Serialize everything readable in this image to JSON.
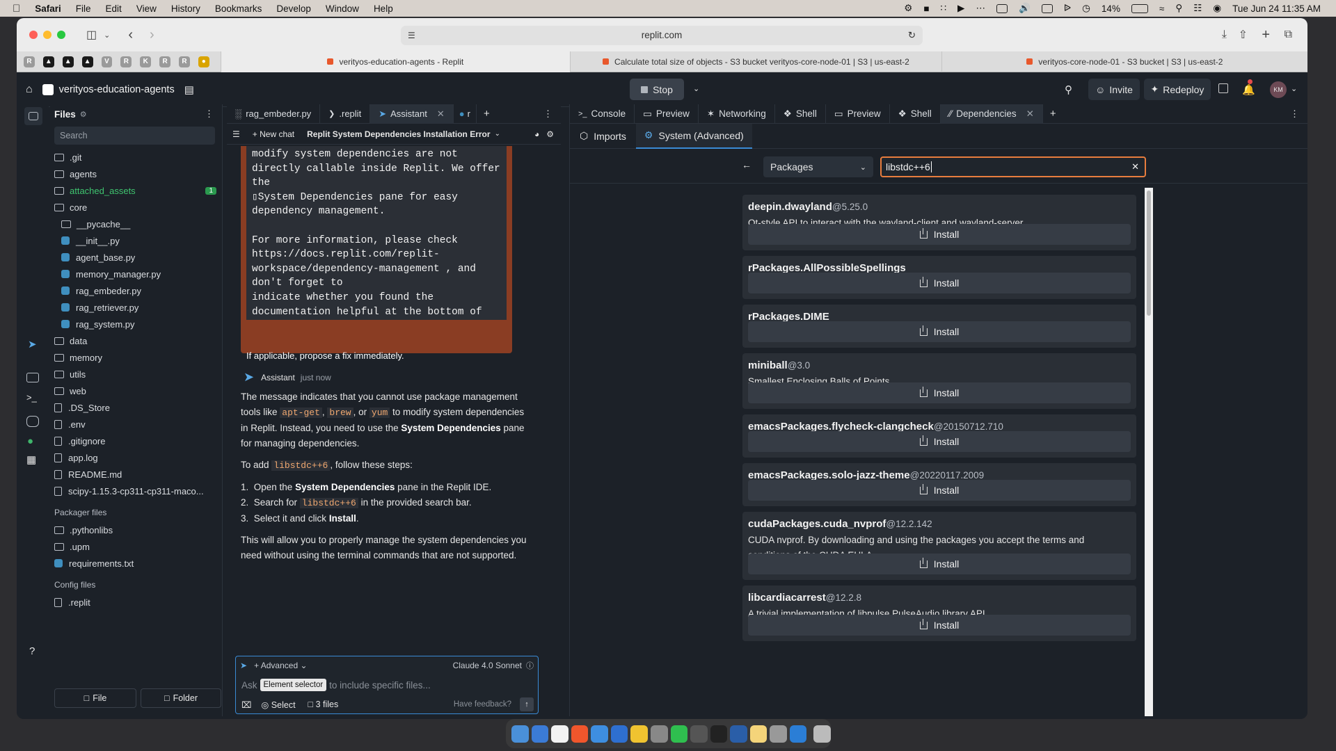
{
  "menubar": {
    "app": "Safari",
    "items": [
      "File",
      "Edit",
      "View",
      "History",
      "Bookmarks",
      "Develop",
      "Window",
      "Help"
    ],
    "battery": "14%",
    "datetime": "Tue Jun 24  11:35 AM"
  },
  "browser": {
    "url": "replit.com",
    "tabs": [
      "verityos-education-agents - Replit",
      "Calculate total size of objects - S3 bucket verityos-core-node-01 | S3 | us-east-2",
      "verityos-core-node-01 - S3 bucket | S3 | us-east-2"
    ],
    "favorites": [
      "R",
      "",
      "",
      "",
      "V",
      "R",
      "K",
      "R",
      "R",
      ""
    ]
  },
  "replit": {
    "project": "verityos-education-agents",
    "stop": "Stop",
    "invite": "Invite",
    "redeploy": "Redeploy",
    "avatar": "KM"
  },
  "files": {
    "header": "Files",
    "search_placeholder": "Search",
    "tree": [
      {
        "name": ".git",
        "type": "folder"
      },
      {
        "name": "agents",
        "type": "folder"
      },
      {
        "name": "attached_assets",
        "type": "folder",
        "badge": "1"
      },
      {
        "name": "core",
        "type": "folder"
      },
      {
        "name": "__pycache__",
        "type": "folder",
        "indent": 1
      },
      {
        "name": "__init__.py",
        "type": "py",
        "indent": 1
      },
      {
        "name": "agent_base.py",
        "type": "py",
        "indent": 1
      },
      {
        "name": "memory_manager.py",
        "type": "py",
        "indent": 1
      },
      {
        "name": "rag_embeder.py",
        "type": "py",
        "indent": 1
      },
      {
        "name": "rag_retriever.py",
        "type": "py",
        "indent": 1
      },
      {
        "name": "rag_system.py",
        "type": "py",
        "indent": 1
      },
      {
        "name": "data",
        "type": "folder"
      },
      {
        "name": "memory",
        "type": "folder"
      },
      {
        "name": "utils",
        "type": "folder"
      },
      {
        "name": "web",
        "type": "folder"
      },
      {
        "name": ".DS_Store",
        "type": "file"
      },
      {
        "name": ".env",
        "type": "file"
      },
      {
        "name": ".gitignore",
        "type": "file"
      },
      {
        "name": "app.log",
        "type": "file"
      },
      {
        "name": "README.md",
        "type": "file"
      },
      {
        "name": "scipy-1.15.3-cp311-cp311-maco...",
        "type": "file"
      }
    ],
    "packager_header": "Packager files",
    "packager": [
      {
        "name": ".pythonlibs",
        "type": "folder"
      },
      {
        "name": ".upm",
        "type": "folder"
      },
      {
        "name": "requirements.txt",
        "type": "py"
      }
    ],
    "config_header": "Config files",
    "config": [
      {
        "name": ".replit",
        "type": "file"
      }
    ],
    "file_btn": "File",
    "folder_btn": "Folder"
  },
  "editor_tabs": [
    "rag_embeder.py",
    ".replit",
    "Assistant",
    "r"
  ],
  "assistant": {
    "new_chat": "New chat",
    "chat_title": "Replit System Dependencies Installation Error",
    "code_block": "modify system dependencies are not\ndirectly callable inside Replit. We offer\nthe\n▯System Dependencies pane for easy\ndependency management.\n\nFor more information, please check\nhttps://docs.replit.com/replit-\nworkspace/dependency-management , and\ndon't forget to\nindicate whether you found the\ndocumentation helpful at the bottom of\nthe page!",
    "propose_fix": "If applicable, propose a fix immediately.",
    "author": "Assistant",
    "time": "just now",
    "p1a": "The message indicates that you cannot use package management tools like ",
    "code_apt": "apt-get",
    "code_brew": "brew",
    "code_yum": "yum",
    "p1b": " to modify system dependencies in Replit. Instead, you need to use the ",
    "p1bold": "System Dependencies",
    "p1c": " pane for managing dependencies.",
    "p2a": "To add ",
    "code_lib": "libstdc++6",
    "p2b": ", follow these steps:",
    "step1a": "Open the ",
    "step1b": "System Dependencies",
    "step1c": " pane in the Replit IDE.",
    "step2a": "Search for ",
    "step2b": " in the provided search bar.",
    "step3a": "Select it and click ",
    "step3b": "Install",
    "step3c": ".",
    "p3": "This will allow you to properly manage the system dependencies you need without using the terminal commands that are not supported.",
    "advanced": "Advanced",
    "model": "Claude 4.0 Sonnet",
    "ask_prefix": "Ask",
    "tooltip": "Element selector",
    "ask_suffix": "to include specific files...",
    "select": "Select",
    "files_count": "3 files",
    "feedback": "Have feedback?"
  },
  "right_tabs": [
    "Console",
    "Preview",
    "Networking",
    "Shell",
    "Preview",
    "Shell",
    "Dependencies"
  ],
  "deps": {
    "subtabs": [
      "Imports",
      "System (Advanced)"
    ],
    "dropdown": "Packages",
    "search_value": "libstdc++6",
    "install_label": "Install",
    "packages": [
      {
        "name": "deepin.dwayland",
        "ver": "@5.25.0",
        "desc": "Qt-style API to interact with the wayland-client and wayland-server"
      },
      {
        "name": "rPackages.AllPossibleSpellings",
        "ver": "",
        "desc": ""
      },
      {
        "name": "rPackages.DIME",
        "ver": "",
        "desc": ""
      },
      {
        "name": "miniball",
        "ver": "@3.0",
        "desc": "Smallest Enclosing Balls of Points"
      },
      {
        "name": "emacsPackages.flycheck-clangcheck",
        "ver": "@20150712.710",
        "desc": ""
      },
      {
        "name": "emacsPackages.solo-jazz-theme",
        "ver": "@20220117.2009",
        "desc": ""
      },
      {
        "name": "cudaPackages.cuda_nvprof",
        "ver": "@12.2.142",
        "desc": "CUDA nvprof. By downloading and using the packages you accept the terms and conditions of the CUDA EULA"
      },
      {
        "name": "libcardiacarrest",
        "ver": "@12.2.8",
        "desc": "A trivial implementation of libpulse PulseAudio library API"
      }
    ]
  },
  "colors": {
    "accent": "#3a8bd6",
    "replit_orange": "#f26207",
    "badge_green": "#2b9a4f"
  }
}
